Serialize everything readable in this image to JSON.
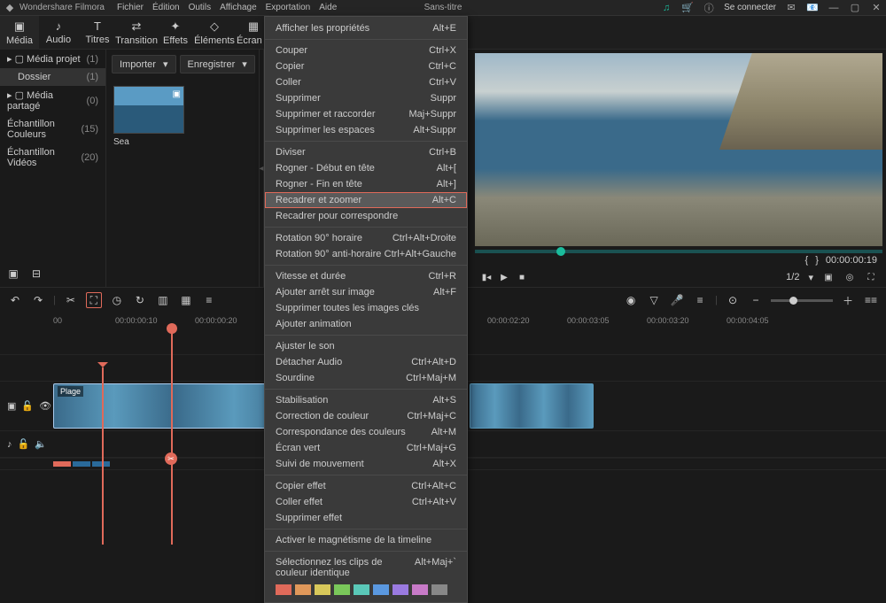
{
  "titlebar": {
    "app": "Wondershare Filmora",
    "doc": "Sans-titre",
    "login": "Se connecter"
  },
  "menubar": {
    "file": "Fichier",
    "edit": "Édition",
    "tools": "Outils",
    "view": "Affichage",
    "export": "Exportation",
    "help": "Aide"
  },
  "tabs": {
    "media": "Média",
    "audio": "Audio",
    "titles": "Titres",
    "transition": "Transition",
    "effects": "Effets",
    "elements": "Éléments",
    "splitscreen": "Écran p"
  },
  "tree": {
    "project": {
      "label": "Média projet",
      "count": "(1)"
    },
    "folder": {
      "label": "Dossier",
      "count": "(1)"
    },
    "shared": {
      "label": "Média partagé",
      "count": "(0)"
    },
    "colors": {
      "label": "Échantillon Couleurs",
      "count": "(15)"
    },
    "videos": {
      "label": "Échantillon Vidéos",
      "count": "(20)"
    }
  },
  "media": {
    "import": "Importer",
    "save": "Enregistrer",
    "thumb_label": "Sea"
  },
  "ctx": {
    "props": {
      "label": "Afficher les propriétés",
      "sc": "Alt+E"
    },
    "cut": {
      "label": "Couper",
      "sc": "Ctrl+X"
    },
    "copy": {
      "label": "Copier",
      "sc": "Ctrl+C"
    },
    "paste": {
      "label": "Coller",
      "sc": "Ctrl+V"
    },
    "delete": {
      "label": "Supprimer",
      "sc": "Suppr"
    },
    "deltrim": {
      "label": "Supprimer et raccorder",
      "sc": "Maj+Suppr"
    },
    "delspace": {
      "label": "Supprimer les espaces",
      "sc": "Alt+Suppr"
    },
    "split": {
      "label": "Diviser",
      "sc": "Ctrl+B"
    },
    "trimstart": {
      "label": "Rogner - Début en tête",
      "sc": "Alt+["
    },
    "trimend": {
      "label": "Rogner - Fin en tête",
      "sc": "Alt+]"
    },
    "cropzoom": {
      "label": "Recadrer et zoomer",
      "sc": "Alt+C"
    },
    "croptofit": {
      "label": "Recadrer pour correspondre",
      "sc": ""
    },
    "rotcw": {
      "label": "Rotation 90° horaire",
      "sc": "Ctrl+Alt+Droite"
    },
    "rotccw": {
      "label": "Rotation 90° anti-horaire",
      "sc": "Ctrl+Alt+Gauche"
    },
    "speed": {
      "label": "Vitesse et durée",
      "sc": "Ctrl+R"
    },
    "freeze": {
      "label": "Ajouter arrêt sur image",
      "sc": "Alt+F"
    },
    "delkf": {
      "label": "Supprimer toutes les images clés",
      "sc": ""
    },
    "addanim": {
      "label": "Ajouter animation",
      "sc": ""
    },
    "adjaudio": {
      "label": "Ajuster le son",
      "sc": ""
    },
    "detach": {
      "label": "Détacher Audio",
      "sc": "Ctrl+Alt+D"
    },
    "mute": {
      "label": "Sourdine",
      "sc": "Ctrl+Maj+M"
    },
    "stab": {
      "label": "Stabilisation",
      "sc": "Alt+S"
    },
    "color": {
      "label": "Correction de couleur",
      "sc": "Ctrl+Maj+C"
    },
    "cmatch": {
      "label": "Correspondance des couleurs",
      "sc": "Alt+M"
    },
    "green": {
      "label": "Écran vert",
      "sc": "Ctrl+Maj+G"
    },
    "motion": {
      "label": "Suivi de mouvement",
      "sc": "Alt+X"
    },
    "copyfx": {
      "label": "Copier effet",
      "sc": "Ctrl+Alt+C"
    },
    "pastefx": {
      "label": "Coller effet",
      "sc": "Ctrl+Alt+V"
    },
    "delfx": {
      "label": "Supprimer effet",
      "sc": ""
    },
    "snap": {
      "label": "Activer le magnétisme de la timeline",
      "sc": ""
    },
    "selcolor": {
      "label": "Sélectionnez les clips de couleur identique",
      "sc": "Alt+Maj+`"
    }
  },
  "preview": {
    "pos": "00:00:00:19",
    "dur": "00:00:00:19",
    "ratio": "1/2"
  },
  "ruler": {
    "t0": "00",
    "t1": "00:00:00:10",
    "t2": "00:00:00:20",
    "t3": "00:00:02:20",
    "t4": "00:00:03:05",
    "t5": "00:00:03:20",
    "t6": "00:00:04:05"
  },
  "clip": {
    "label": "Plage"
  },
  "colors": [
    "#e06a5a",
    "#e0985a",
    "#d8c85a",
    "#7ac85a",
    "#5ac8b8",
    "#5a98e0",
    "#9a7ae0",
    "#c87ac8",
    "#888888"
  ]
}
